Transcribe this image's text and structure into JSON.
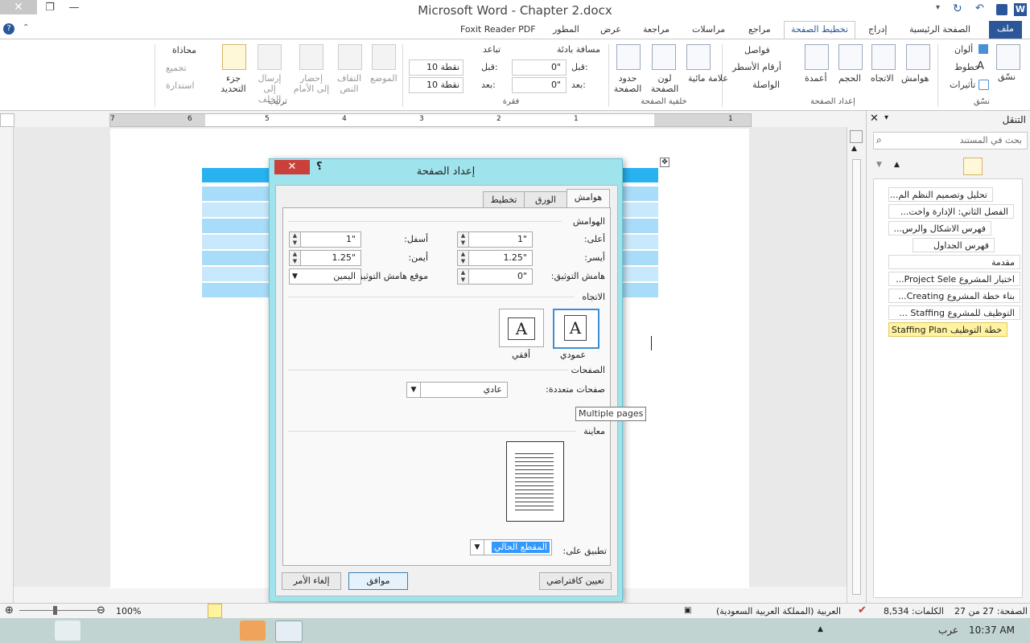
{
  "window": {
    "title": "Microsoft Word - Chapter 2.docx",
    "close_glyph": "✕",
    "restore_glyph": "❐",
    "minimize_glyph": "—"
  },
  "quick_access": [
    "W",
    "save",
    "undo",
    "redo",
    "customize"
  ],
  "tabs": {
    "file": "ملف",
    "home": "الصفحة الرئيسية",
    "insert": "إدراج",
    "page_layout": "تخطيط الصفحة",
    "references": "مراجع",
    "mailings": "مراسلات",
    "review": "مراجعة",
    "view": "عرض",
    "developer": "المطور",
    "foxit": "Foxit Reader PDF"
  },
  "ribbon": {
    "themes_group": {
      "label": "نسّق",
      "themes": "نسّق",
      "colors": "ألوان",
      "fonts": "خطوط",
      "effects": "تأثيرات"
    },
    "page_setup_group": {
      "label": "إعداد الصفحة",
      "margins": "هوامش",
      "orientation": "الاتجاه",
      "size": "الحجم",
      "columns": "أعمدة",
      "breaks": "فواصل",
      "line_numbers": "أرقام الأسطر",
      "hyphenation": "الواصلة"
    },
    "page_background_group": {
      "label": "خلفية الصفحة",
      "watermark": "علامة مائية",
      "page_color": "لون الصفحة",
      "page_borders": "حدود الصفحة"
    },
    "paragraph_group": {
      "label": "فقرة",
      "indent": "مسافة بادئة",
      "spacing": "تباعد",
      "before_label": "قبل:",
      "after_label": "بعد:",
      "indent_before": "0\"",
      "indent_after": "0\"",
      "spacing_before": "10 نقطة",
      "spacing_after": "10 نقطة"
    },
    "arrange_group": {
      "label": "ترتيب",
      "position": "الموضع",
      "wrap_text": "التفاف النص",
      "bring_forward": "إحضار إلى الأمام",
      "send_backward": "إرسال إلى الخلف",
      "selection_pane": "جزء التحديد",
      "align": "محاذاة",
      "group": "تجميع",
      "rotate": "استدارة"
    }
  },
  "ruler": {
    "numbers": [
      "7",
      "6",
      "5",
      "4",
      "3",
      "2",
      "1",
      "1"
    ]
  },
  "nav_pane": {
    "title": "التنقل",
    "search_placeholder": "بحث في المستند",
    "items": [
      {
        "text": "تحليل وتصميم النظم  الم...",
        "level": 1,
        "selected": false
      },
      {
        "text": "الفصل الثاني: الإدارة واخت...",
        "level": 1,
        "selected": false
      },
      {
        "text": "فهرس الاشكال والرس...",
        "level": 2,
        "selected": false
      },
      {
        "text": "فهرس الجداول",
        "level": 2,
        "selected": false
      },
      {
        "text": "مقدمة",
        "level": 1,
        "selected": false
      },
      {
        "text": "اختيار المشروع Project Sele...",
        "level": 1,
        "selected": false
      },
      {
        "text": "بناء خطة المشروع  Creating...",
        "level": 1,
        "selected": false
      },
      {
        "text": "التوظيف للمشروع Staffing ...",
        "level": 1,
        "selected": false
      },
      {
        "text": "خطة التوظيف Staffing Plan",
        "level": 2,
        "selected": true
      }
    ]
  },
  "dialog": {
    "title": "إعداد الصفحة",
    "help": "؟",
    "close": "✕",
    "tabs": [
      "هوامش",
      "الورق",
      "تخطيط"
    ],
    "margins_section": "الهوامش",
    "top_label": "أعلى:",
    "top_value": "1\"",
    "bottom_label": "أسفل:",
    "bottom_value": "1\"",
    "left_label": "أيسر:",
    "left_value": "1.25\"",
    "right_label": "أيمن:",
    "right_value": "1.25\"",
    "gutter_label": "هامش التوثيق:",
    "gutter_value": "0\"",
    "gutter_pos_label": "موقع هامش التوثيق:",
    "gutter_pos_value": "اليمين",
    "orientation_section": "الاتجاه",
    "portrait": "عمودي",
    "landscape": "أفقي",
    "pages_section": "الصفحات",
    "multiple_pages_label": "صفحات متعددة:",
    "multiple_pages_value": "عادي",
    "tooltip": "Multiple pages",
    "preview_section": "معاينة",
    "apply_to_label": "تطبيق على:",
    "apply_to_value": "المقطع الحالي",
    "set_default": "تعيين كافتراضي",
    "ok": "موافق",
    "cancel": "إلغاء الأمر"
  },
  "status": {
    "page": "الصفحة: 27 من 27",
    "words": "الكلمات: 8,534",
    "language": "العربية (المملكة العربية السعودية)",
    "zoom": "100%"
  },
  "taskbar": {
    "time": "10:37 AM",
    "lang": "عرب",
    "apps": [
      "start",
      "chrome",
      "ie",
      "firefox",
      "explorer",
      "paint",
      "pdf",
      "word",
      "tools"
    ]
  },
  "colors": {
    "file_tab": "#2b579a",
    "dialog_frame": "#9fe3ec",
    "dialog_close": "#c9413a",
    "table_header": "#29b2f0",
    "table_row": "#a9dcf9",
    "selected_heading": "#fff3a0"
  }
}
